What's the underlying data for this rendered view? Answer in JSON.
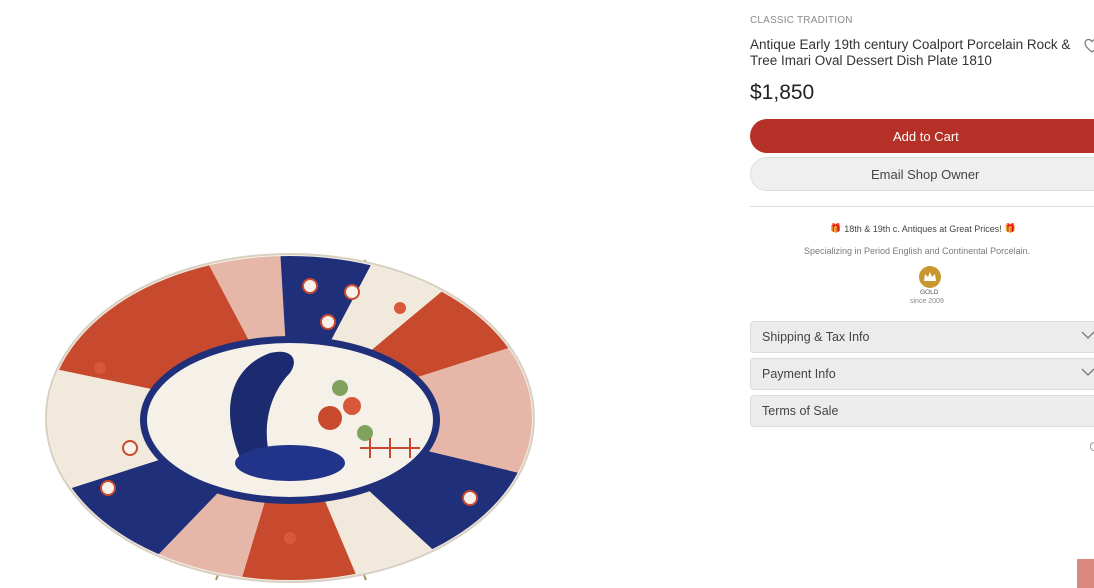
{
  "product": {
    "shop_name": "CLASSIC TRADITION",
    "title": "Antique Early 19th century Coalport Porcelain Rock & Tree Imari Oval Dessert Dish Plate 1810",
    "price": "$1,850",
    "image_alt": "Coalport Imari oval dessert dish"
  },
  "actions": {
    "add_to_cart": "Add to Cart",
    "email_owner": "Email Shop Owner"
  },
  "shop_info": {
    "tagline": "18th & 19th c. Antiques at Great Prices!",
    "specialty": "Specializing in Period English and Continental Porcelain.",
    "badge_level": "GOLD",
    "member_since": "since 2009"
  },
  "accordions": [
    {
      "label": "Shipping & Tax Info"
    },
    {
      "label": "Payment Info"
    },
    {
      "label": "Terms of Sale"
    }
  ],
  "colors": {
    "accent": "#b53127",
    "gold": "#c8972f",
    "button_gray": "#efefef"
  },
  "icons": {
    "favorite": "heart-icon",
    "expand": "chevron-down-icon",
    "badge": "crown-icon"
  }
}
